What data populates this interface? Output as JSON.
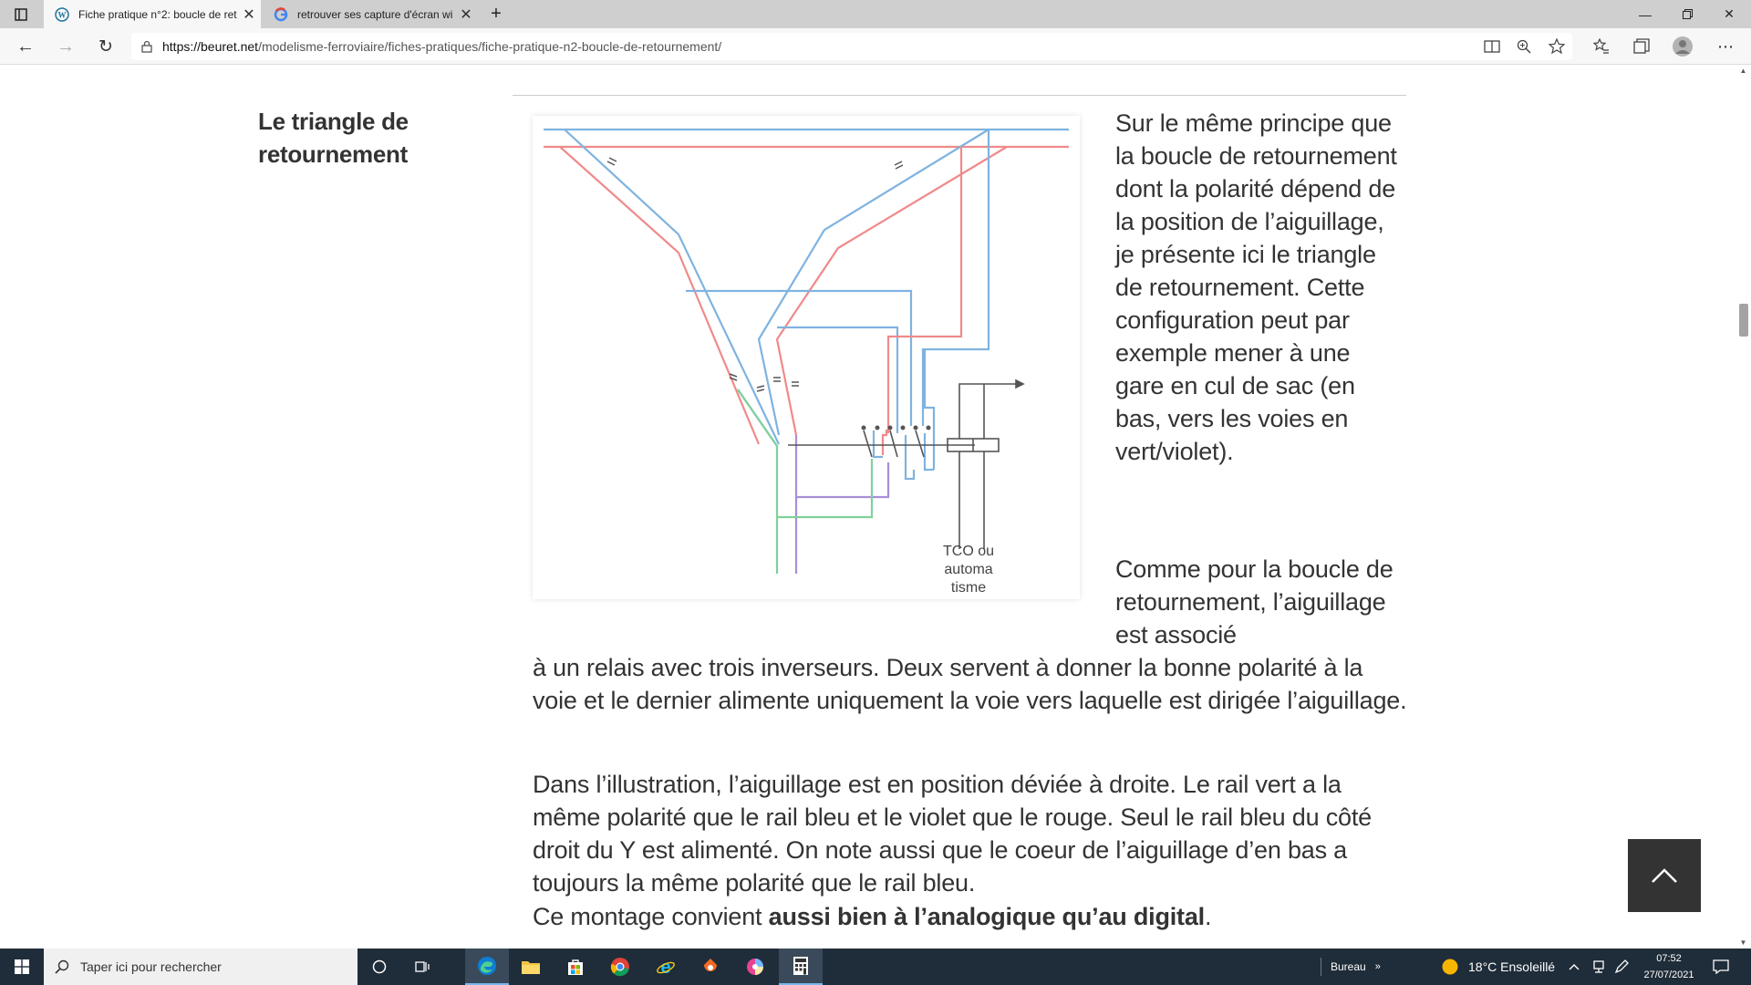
{
  "browser": {
    "tabs": [
      {
        "title": "Fiche pratique n°2: boucle de ret",
        "active": true
      },
      {
        "title": "retrouver ses capture d'écran wi",
        "active": false
      }
    ],
    "url_host": "https://beuret.net",
    "url_path": "/modelisme-ferroviaire/fiches-pratiques/fiche-pratique-n2-boucle-de-retournement/"
  },
  "article": {
    "section_title": "Le triangle de retournement",
    "p1": "Sur le même principe que la boucle de retournement dont la polarité dépend de la position de l’aiguillage, je présente ici le triangle de retournement. Cette configuration peut par exemple mener à une gare en cul de sac (en bas, vers les voies en vert/violet).",
    "p2_part1": "Comme pour la boucle de retournement, l’aiguillage est associé",
    "p2_part2": "à un relais avec trois inverseurs. Deux servent à donner la bonne polarité à la voie et le dernier alimente uniquement la voie vers laquelle est dirigée l’aiguillage.",
    "p3": "Dans l’illustration, l’aiguillage est en position déviée à droite. Le rail vert a la même polarité que le rail bleu et le violet que le rouge. Seul le rail bleu du côté droit du Y est alimenté. On note aussi que le coeur de l’aiguillage d’en bas a toujours la même polarité que le rail bleu.",
    "p4_prefix": "Ce montage convient ",
    "p4_bold": "aussi bien à l’analogique qu’au digital",
    "p4_suffix": ".",
    "figure_label_1": "TCO ou",
    "figure_label_2": "automa",
    "figure_label_3": "tisme"
  },
  "taskbar": {
    "search_placeholder": "Taper ici pour rechercher",
    "desktop_label": "Bureau",
    "weather": "18°C  Ensoleillé",
    "time": "07:52",
    "date": "27/07/2021"
  },
  "colors": {
    "rail_blue": "#7fb3e0",
    "rail_red": "#f08a8a",
    "rail_green": "#7fd19a",
    "rail_violet": "#a78fd8",
    "wire_gray": "#555555"
  }
}
